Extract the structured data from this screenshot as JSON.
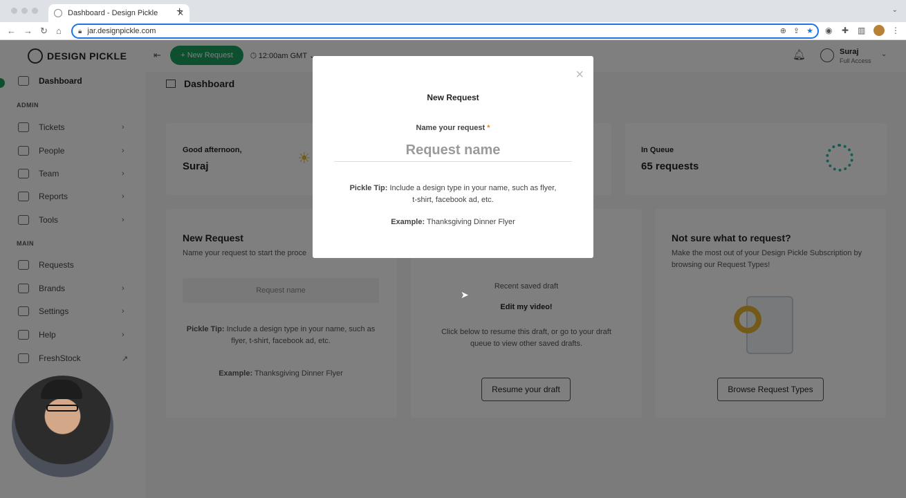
{
  "browser": {
    "tab_title": "Dashboard - Design Pickle",
    "tab_close": "✕",
    "new_tab": "+",
    "url": "jar.designpickle.com"
  },
  "sidebar": {
    "logo": "DESIGN PICKLE",
    "dashboard": "Dashboard",
    "section_admin": "ADMIN",
    "section_main": "MAIN",
    "admin_items": [
      {
        "label": "Tickets",
        "chevron": "›"
      },
      {
        "label": "People",
        "chevron": "›"
      },
      {
        "label": "Team",
        "chevron": "›"
      },
      {
        "label": "Reports",
        "chevron": "›"
      },
      {
        "label": "Tools",
        "chevron": "›"
      }
    ],
    "main_items": [
      {
        "label": "Requests",
        "chevron": ""
      },
      {
        "label": "Brands",
        "chevron": "›"
      },
      {
        "label": "Settings",
        "chevron": "›"
      },
      {
        "label": "Help",
        "chevron": "›"
      },
      {
        "label": "FreshStock",
        "chevron": "↗"
      }
    ]
  },
  "topbar": {
    "new_request": "+ New Request",
    "time": "12:00am GMT",
    "user_name": "Suraj",
    "user_role": "Full Access"
  },
  "page": {
    "breadcrumb": "Dashboard"
  },
  "cards": {
    "greeting_label": "Good afternoon,",
    "greeting_name": "Suraj",
    "queue_label": "In Queue",
    "queue_value": "65 requests",
    "new_request_title": "New Request",
    "new_request_desc": "Name your request to start the proce",
    "new_request_placeholder": "Request name",
    "tip_bold": "Pickle Tip:",
    "tip_text": "Include a design type in your name, such as flyer, t-shirt, facebook ad, etc.",
    "example_bold": "Example:",
    "example_text": "Thanksgiving Dinner Flyer",
    "draft_recent": "Recent saved draft",
    "draft_name": "Edit my video!",
    "draft_desc": "Click below to resume this draft, or go to your draft queue to view other saved drafts.",
    "resume_btn": "Resume your draft",
    "notsure_title": "Not sure what to request?",
    "notsure_desc": "Make the most out of your Design Pickle Subscription by browsing our Request Types!",
    "browse_btn": "Browse Request Types"
  },
  "modal": {
    "title": "New Request",
    "close": "×",
    "label": "Name your request",
    "required_mark": "*",
    "placeholder": "Request name",
    "tip_bold": "Pickle Tip:",
    "tip_text": "Include a design type in your name, such as flyer, t-shirt, facebook ad, etc.",
    "example_bold": "Example:",
    "example_text": "Thanksgiving Dinner Flyer"
  },
  "colors": {
    "brand_green": "#1b9e5c",
    "required": "#e0822b",
    "focus_blue": "#1a73e8"
  }
}
